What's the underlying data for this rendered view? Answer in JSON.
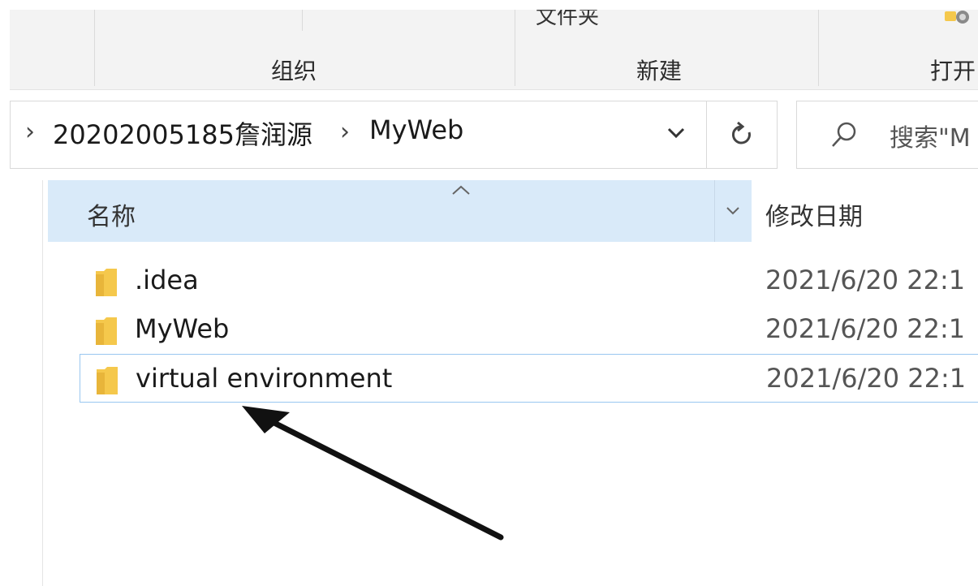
{
  "ribbon": {
    "partial_top_label": "文件夹",
    "groups": {
      "organize": "组织",
      "new": "新建",
      "open": "打开"
    }
  },
  "address": {
    "breadcrumbs": [
      "20202005185詹润源",
      "MyWeb"
    ]
  },
  "search": {
    "placeholder": "搜索\"M"
  },
  "columns": {
    "name": "名称",
    "modified": "修改日期"
  },
  "files": [
    {
      "name": ".idea",
      "modified": "2021/6/20 22:1",
      "type": "folder",
      "selected": false
    },
    {
      "name": "MyWeb",
      "modified": "2021/6/20 22:1",
      "type": "folder",
      "selected": false
    },
    {
      "name": "virtual environment",
      "modified": "2021/6/20 22:1",
      "type": "folder",
      "selected": true
    }
  ],
  "colors": {
    "header_highlight": "#d9eaf9",
    "selection_border": "#99c7f0",
    "folder_yellow": "#f5c84c",
    "annotation": "#111111"
  }
}
